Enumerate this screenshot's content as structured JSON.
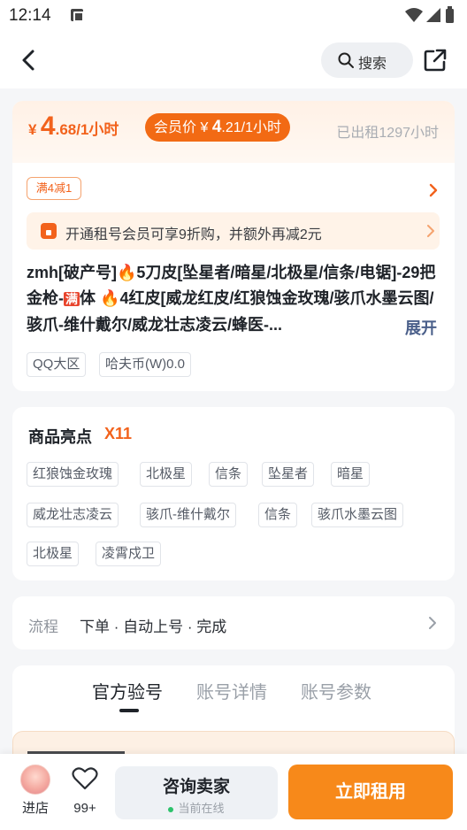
{
  "status_bar": {
    "time": "12:14"
  },
  "nav": {
    "search_label": "搜索"
  },
  "pricing": {
    "currency": "¥",
    "price_int": "4",
    "price_rest": ".68/1小时",
    "member_label": "会员价",
    "member_currency": "¥",
    "member_int": "4",
    "member_rest": ".21/1小时",
    "rented": "已出租1297小时"
  },
  "coupon": {
    "label": "满4减1"
  },
  "vip_banner": {
    "text": "开通租号会员可享9折购，并额外再减2元"
  },
  "listing": {
    "title_1": "zmh[破产号]",
    "emoji_1": "🔥",
    "title_2": "5刀皮[坠星者/暗星/北极星/信条/电锯]-29把金枪-",
    "hot_badge": "满",
    "title_3": "体 ",
    "emoji_2": "🔥",
    "title_4": "4红皮[威龙红皮/红狼蚀金玫瑰/骇爪水墨云图/骇爪-维什戴尔/威龙壮志凌云/蜂医-...",
    "expand_label": "展开",
    "tags": [
      "QQ大区",
      "哈夫币(W)0.0"
    ]
  },
  "highlights": {
    "title": "商品亮点",
    "count": "X11",
    "tags": [
      "红狼蚀金玫瑰",
      "北极星",
      "信条",
      "坠星者",
      "暗星",
      "威龙壮志凌云",
      "骇爪-维什戴尔",
      "信条",
      "骇爪水墨云图",
      "北极星",
      "凌霄戍卫"
    ]
  },
  "flow": {
    "label": "流程",
    "steps": "下单 · 自动上号 · 完成"
  },
  "tabs": [
    "官方验号",
    "账号详情",
    "账号参数"
  ],
  "bottom_bar": {
    "store_label": "进店",
    "fav_count": "99+",
    "consult_label": "咨询卖家",
    "consult_status": "当前在线",
    "rent_label": "立即租用"
  },
  "colors": {
    "accent": "#f2621c",
    "primary_button": "#f7891a",
    "online": "#2cc26b"
  }
}
